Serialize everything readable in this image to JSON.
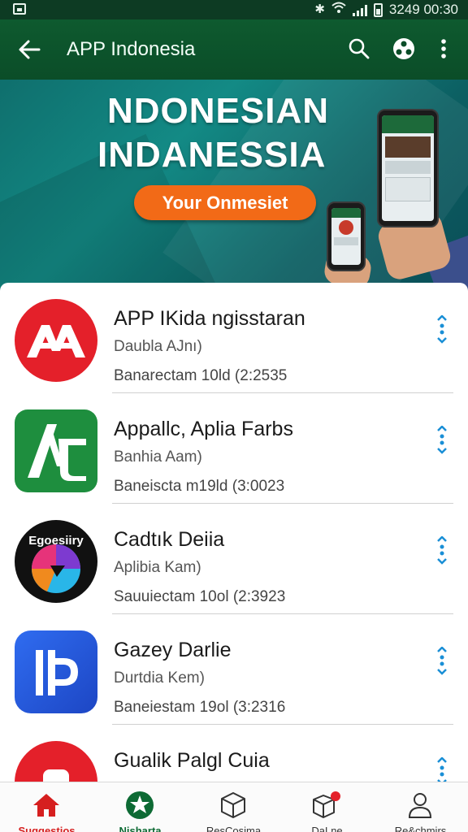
{
  "status_bar": {
    "time": "3249 00:30"
  },
  "app_bar": {
    "title": "APP Indonesia"
  },
  "banner": {
    "heading_line1": "NDONESIAN",
    "heading_line2": "INDANESSIA",
    "cta_label": "Your Onmesiet"
  },
  "apps": [
    {
      "name": "APP IKida ngisstaran",
      "subtitle": "Daubla AJnı)",
      "meta": "Banarectam 10ld  (2:2535",
      "icon": "red-aa-logo",
      "color": "#e4202a"
    },
    {
      "name": "Appallc, Aplia Farbs",
      "subtitle": "Banhia Aam)",
      "meta": "Baneiscta m19ld  (3:0023",
      "icon": "green-af-logo",
      "color": "#1e8e3e"
    },
    {
      "name": "Cadtık Deiia",
      "subtitle": "Aplibia Kam)",
      "meta": "Sauuiectam 10ol  (2:3923",
      "icon": "egosiiry-logo",
      "color": "#111111",
      "icon_text": "Egoesiiry"
    },
    {
      "name": "Gazey Darlie",
      "subtitle": "Durtdia Kem)",
      "meta": "Baneiestam 19ol  (3:2316",
      "icon": "blue-ip-logo",
      "color": "#2357d9"
    },
    {
      "name": "Gualik Palgl Cuia",
      "subtitle": "",
      "meta": "",
      "icon": "red-partial-logo",
      "color": "#e4202a"
    }
  ],
  "bottom_nav": [
    {
      "label": "Suggestios",
      "icon": "home-icon",
      "color": "#d61f1f"
    },
    {
      "label": "Nisharta",
      "icon": "star-badge-icon",
      "color": "#0d6a34"
    },
    {
      "label": "ResCosima",
      "icon": "cube-icon",
      "color": "#333333"
    },
    {
      "label": "DaLne",
      "icon": "box-badge-icon",
      "color": "#333333"
    },
    {
      "label": "Re&chmirs",
      "icon": "person-icon",
      "color": "#333333"
    }
  ]
}
